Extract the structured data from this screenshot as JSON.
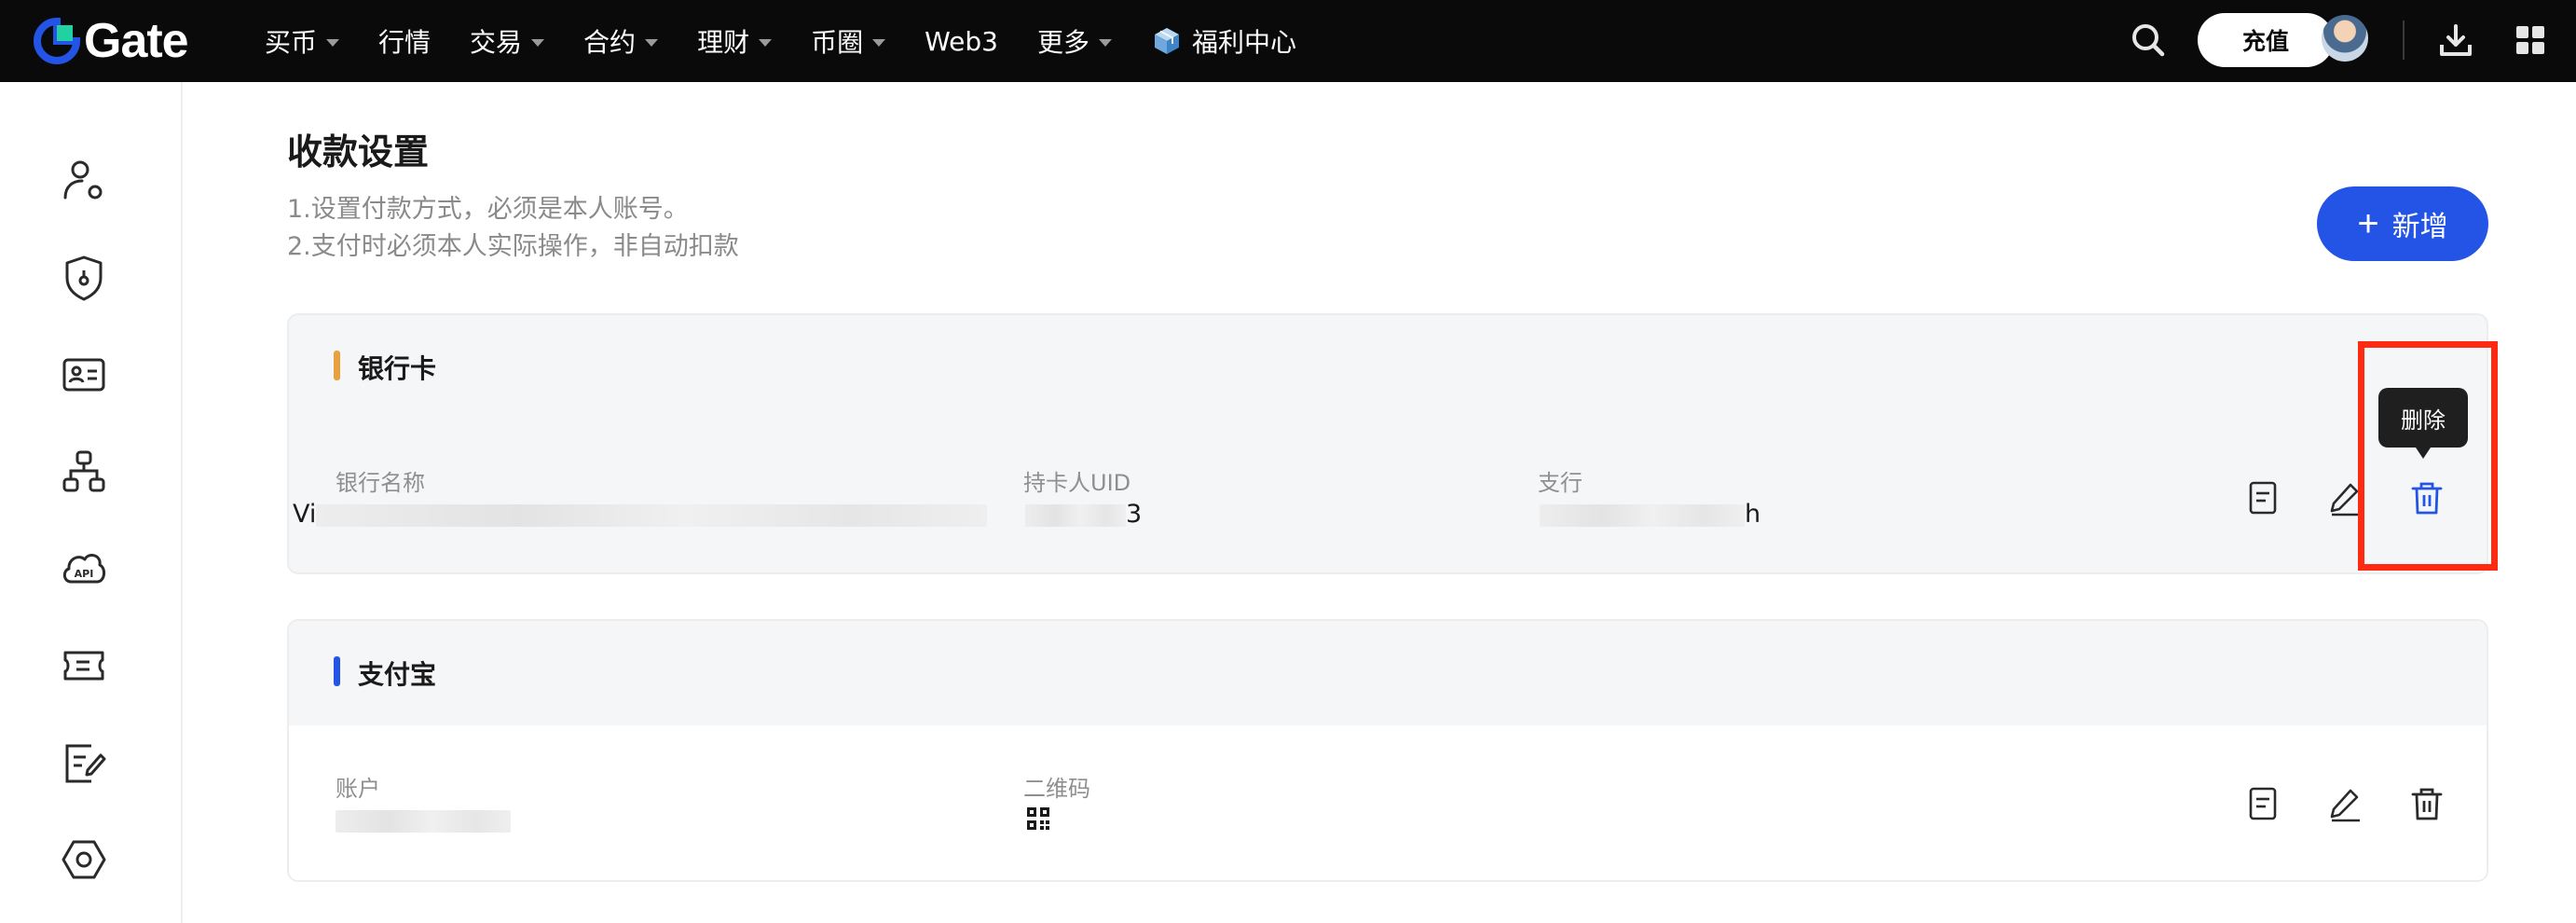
{
  "brand": {
    "name": "Gate",
    "accent": "#2354e6"
  },
  "nav": {
    "items": [
      {
        "label": "买币",
        "has_dropdown": true
      },
      {
        "label": "行情",
        "has_dropdown": false
      },
      {
        "label": "交易",
        "has_dropdown": true
      },
      {
        "label": "合约",
        "has_dropdown": true
      },
      {
        "label": "理财",
        "has_dropdown": true
      },
      {
        "label": "币圈",
        "has_dropdown": true
      },
      {
        "label": "Web3",
        "has_dropdown": false
      },
      {
        "label": "更多",
        "has_dropdown": true
      },
      {
        "label": "福利中心",
        "has_dropdown": false,
        "icon": "gift-box-icon"
      }
    ],
    "deposit_label": "充值"
  },
  "sidebar": {
    "icons": [
      "user-settings-icon",
      "security-shield-icon",
      "id-card-icon",
      "sub-account-icon",
      "api-icon",
      "coupon-icon",
      "notes-edit-icon",
      "settings-hexagon-icon"
    ]
  },
  "page": {
    "title": "收款设置",
    "notes": [
      "1.设置付款方式，必须是本人账号。",
      "2.支付时必须本人实际操作，非自动扣款"
    ],
    "add_label": "新增"
  },
  "cards": {
    "bank": {
      "title": "银行卡",
      "accent_color": "#e8a23d",
      "fields": [
        {
          "label": "银行名称",
          "value_prefix": "Vi",
          "value_suffix": ""
        },
        {
          "label": "持卡人UID",
          "value_prefix": "",
          "value_suffix": "3"
        },
        {
          "label": "支行",
          "value_prefix": "",
          "value_suffix": "h"
        }
      ]
    },
    "alipay": {
      "title": "支付宝",
      "accent_color": "#2354e6",
      "fields": [
        {
          "label": "账户"
        },
        {
          "label": "二维码"
        }
      ]
    }
  },
  "tooltip": {
    "label": "删除"
  },
  "highlight_color": "#ff2a12"
}
